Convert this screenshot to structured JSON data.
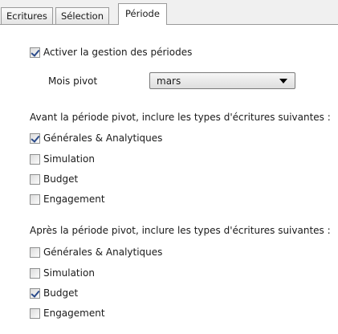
{
  "tabs": [
    {
      "label": "Ecritures",
      "active": false
    },
    {
      "label": "Sélection",
      "active": false
    },
    {
      "label": "Période",
      "active": true
    }
  ],
  "period": {
    "enable_label": "Activer la gestion des périodes",
    "enable_checked": true,
    "pivot_label": "Mois pivot",
    "pivot_value": "mars"
  },
  "before": {
    "heading": "Avant la période pivot, inclure les types d'écritures suivantes :",
    "options": [
      {
        "label": "Générales & Analytiques",
        "checked": true
      },
      {
        "label": "Simulation",
        "checked": false
      },
      {
        "label": "Budget",
        "checked": false
      },
      {
        "label": "Engagement",
        "checked": false
      }
    ]
  },
  "after": {
    "heading": "Après la période pivot, inclure les types d'écritures suivantes :",
    "options": [
      {
        "label": "Générales & Analytiques",
        "checked": false
      },
      {
        "label": "Simulation",
        "checked": false
      },
      {
        "label": "Budget",
        "checked": true
      },
      {
        "label": "Engagement",
        "checked": false
      }
    ]
  }
}
